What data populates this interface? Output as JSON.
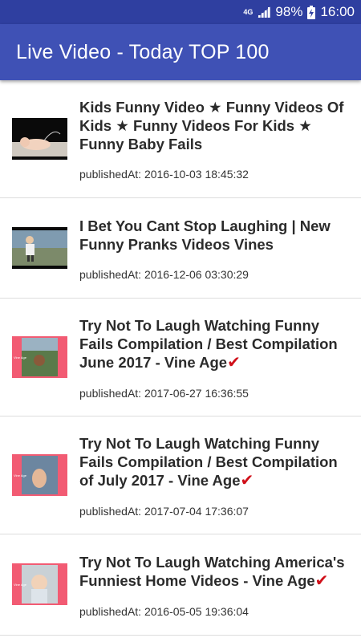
{
  "status_bar": {
    "network": "4G",
    "battery": "98%",
    "time": "16:00"
  },
  "app_bar": {
    "title": "Live Video - Today TOP 100"
  },
  "videos": [
    {
      "title": "Kids Funny Video ★ Funny Videos Of Kids ★ Funny Videos For Kids ★ Funny Baby Fails",
      "published": "publishedAt: 2016-10-03 18:45:32",
      "verified": false
    },
    {
      "title": "I Bet You Cant Stop Laughing | New Funny Pranks Videos Vines",
      "published": "publishedAt: 2016-12-06 03:30:29",
      "verified": false
    },
    {
      "title": "Try Not To Laugh Watching Funny Fails Compilation / Best Compilation June 2017 - Vine Age",
      "published": "publishedAt: 2017-06-27 16:36:55",
      "verified": true
    },
    {
      "title": "Try Not To Laugh Watching Funny Fails Compilation / Best Compilation of July 2017 - Vine Age",
      "published": "publishedAt: 2017-07-04 17:36:07",
      "verified": true
    },
    {
      "title": "Try Not To Laugh Watching America's Funniest Home Videos - Vine Age",
      "published": "publishedAt: 2016-05-05 19:36:04",
      "verified": true
    }
  ],
  "check_glyph": "✔",
  "colors": {
    "status_bar": "#2f3fa0",
    "app_bar": "#3f51b5",
    "verified_check": "#d0101a",
    "thumb_frame_pink": "#f25b73"
  }
}
